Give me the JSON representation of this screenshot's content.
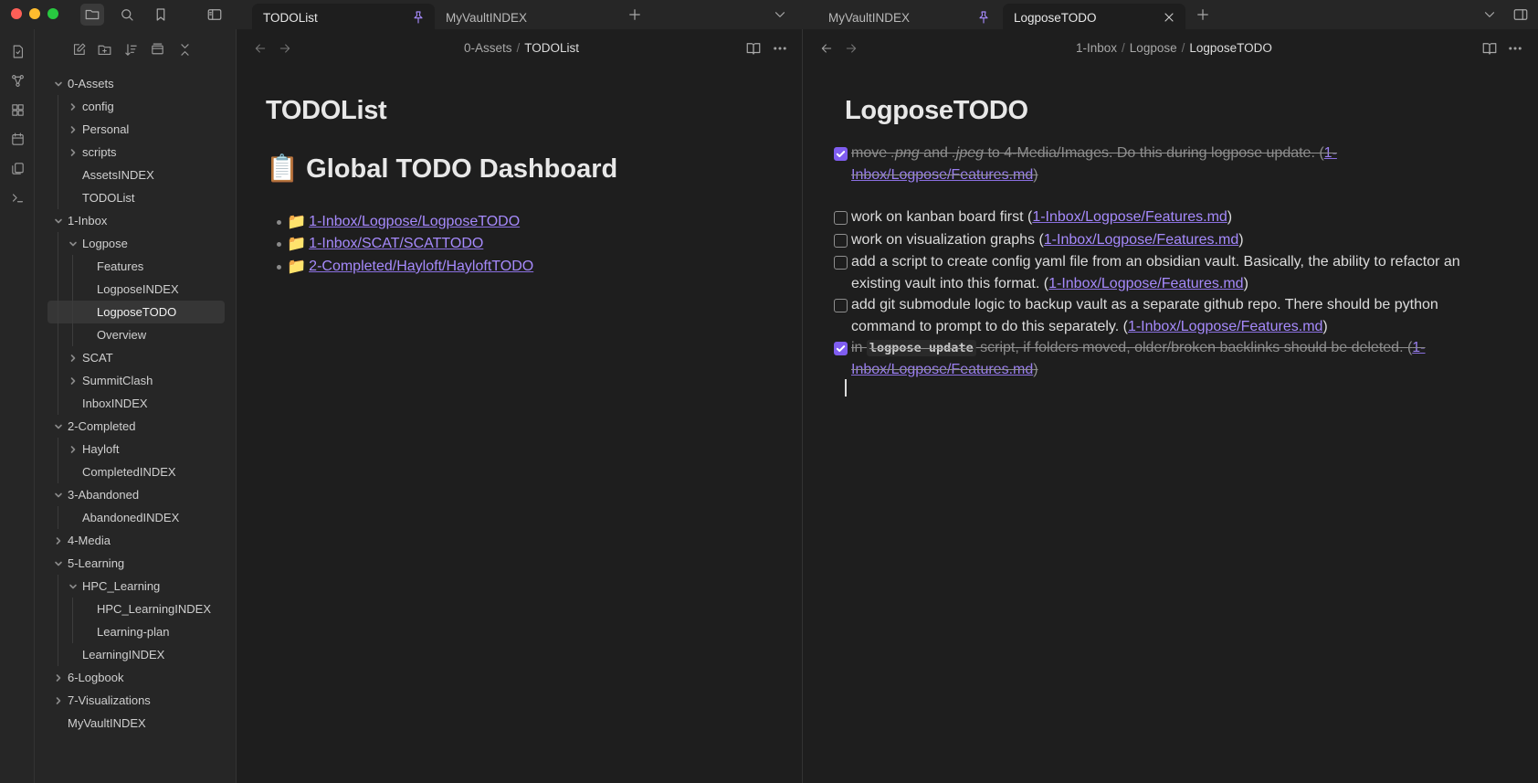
{
  "tabs": {
    "left": [
      {
        "label": "TODOList",
        "active": true,
        "pinned": true
      },
      {
        "label": "MyVaultINDEX",
        "active": false,
        "pinned": false
      }
    ],
    "right": [
      {
        "label": "MyVaultINDEX",
        "active": false,
        "pinned": true
      },
      {
        "label": "LogposeTODO",
        "active": true,
        "pinned": false
      }
    ]
  },
  "explorer": {
    "items": [
      {
        "label": "0-Assets",
        "depth": 0,
        "chevron": "down"
      },
      {
        "label": "config",
        "depth": 1,
        "chevron": "right"
      },
      {
        "label": "Personal",
        "depth": 1,
        "chevron": "right"
      },
      {
        "label": "scripts",
        "depth": 1,
        "chevron": "right"
      },
      {
        "label": "AssetsINDEX",
        "depth": 1,
        "chevron": "none"
      },
      {
        "label": "TODOList",
        "depth": 1,
        "chevron": "none"
      },
      {
        "label": "1-Inbox",
        "depth": 0,
        "chevron": "down"
      },
      {
        "label": "Logpose",
        "depth": 1,
        "chevron": "down"
      },
      {
        "label": "Features",
        "depth": 2,
        "chevron": "none"
      },
      {
        "label": "LogposeINDEX",
        "depth": 2,
        "chevron": "none"
      },
      {
        "label": "LogposeTODO",
        "depth": 2,
        "chevron": "none",
        "selected": true
      },
      {
        "label": "Overview",
        "depth": 2,
        "chevron": "none"
      },
      {
        "label": "SCAT",
        "depth": 1,
        "chevron": "right"
      },
      {
        "label": "SummitClash",
        "depth": 1,
        "chevron": "right"
      },
      {
        "label": "InboxINDEX",
        "depth": 1,
        "chevron": "none"
      },
      {
        "label": "2-Completed",
        "depth": 0,
        "chevron": "down"
      },
      {
        "label": "Hayloft",
        "depth": 1,
        "chevron": "right"
      },
      {
        "label": "CompletedINDEX",
        "depth": 1,
        "chevron": "none"
      },
      {
        "label": "3-Abandoned",
        "depth": 0,
        "chevron": "down"
      },
      {
        "label": "AbandonedINDEX",
        "depth": 1,
        "chevron": "none"
      },
      {
        "label": "4-Media",
        "depth": 0,
        "chevron": "right"
      },
      {
        "label": "5-Learning",
        "depth": 0,
        "chevron": "down"
      },
      {
        "label": "HPC_Learning",
        "depth": 1,
        "chevron": "down"
      },
      {
        "label": "HPC_LearningINDEX",
        "depth": 2,
        "chevron": "none"
      },
      {
        "label": "Learning-plan",
        "depth": 2,
        "chevron": "none"
      },
      {
        "label": "LearningINDEX",
        "depth": 1,
        "chevron": "none"
      },
      {
        "label": "6-Logbook",
        "depth": 0,
        "chevron": "right"
      },
      {
        "label": "7-Visualizations",
        "depth": 0,
        "chevron": "right"
      },
      {
        "label": "MyVaultINDEX",
        "depth": 0,
        "chevron": "none"
      }
    ]
  },
  "left_pane": {
    "breadcrumb": [
      "0-Assets",
      "TODOList"
    ],
    "title": "TODOList",
    "heading_emoji": "📋",
    "heading": "Global TODO Dashboard",
    "links": [
      {
        "emoji": "📁",
        "text": "1-Inbox/Logpose/LogposeTODO"
      },
      {
        "emoji": "📁",
        "text": "1-Inbox/SCAT/SCATTODO"
      },
      {
        "emoji": "📁",
        "text": "2-Completed/Hayloft/HayloftTODO"
      }
    ]
  },
  "right_pane": {
    "breadcrumb": [
      "1-Inbox",
      "Logpose",
      "LogposeTODO"
    ],
    "title": "LogposeTODO",
    "tasks": [
      {
        "done": true,
        "parts": [
          "move ",
          ".png",
          " and ",
          ".jpeg",
          " to 4-Media/Images. Do this during logpose update. ("
        ],
        "link": "1-Inbox/Logpose/Features.md",
        "tail": ")"
      },
      {
        "done": false,
        "text": "work on kanban board first (",
        "link": "1-Inbox/Logpose/Features.md",
        "tail": ")"
      },
      {
        "done": false,
        "text": "work on visualization graphs (",
        "link": "1-Inbox/Logpose/Features.md",
        "tail": ")"
      },
      {
        "done": false,
        "text": "add a script to create config yaml file from an obsidian vault. Basically, the ability to refactor an existing vault into this format. (",
        "link": "1-Inbox/Logpose/Features.md",
        "tail": ")"
      },
      {
        "done": false,
        "text": "add git submodule logic to backup vault as a separate github repo. There should be python command to prompt to do this separately. (",
        "link": "1-Inbox/Logpose/Features.md",
        "tail": ")"
      },
      {
        "done": true,
        "pre": "in ",
        "code": "logpose update",
        "text": " script, if folders moved, older/broken backlinks should be deleted. (",
        "link": "1-Inbox/Logpose/Features.md",
        "tail": ")"
      }
    ]
  },
  "colors": {
    "accent": "#a68afc",
    "checkbox": "#7f5df0",
    "bg": "#1e1e1e",
    "sidebar": "#262626"
  }
}
